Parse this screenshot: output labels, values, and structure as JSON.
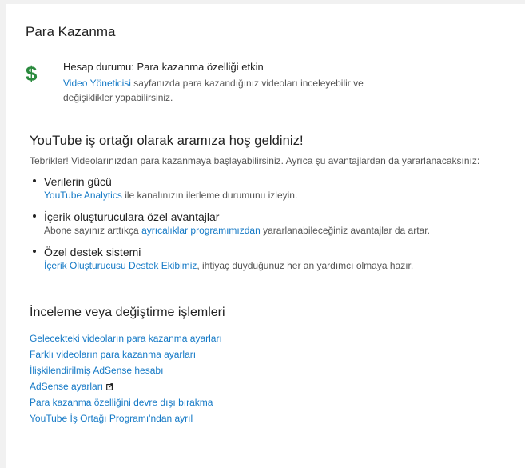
{
  "page_title": "Para Kazanma",
  "status": {
    "icon": "dollar-icon",
    "line": "Hesap durumu: Para kazanma özelliği etkin",
    "desc_link": "Video Yöneticisi",
    "desc_rest": " sayfanızda para kazandığınız videoları inceleyebilir ve değişiklikler yapabilirsiniz."
  },
  "welcome": {
    "title": "YouTube iş ortağı olarak aramıza hoş geldiniz!",
    "intro": "Tebrikler! Videolarınızdan para kazanmaya başlayabilirsiniz. Ayrıca şu avantajlardan da yararlanacaksınız:",
    "benefits": [
      {
        "title": "Verilerin gücü",
        "pre": "",
        "link": "YouTube Analytics",
        "post": " ile kanalınızın ilerleme durumunu izleyin."
      },
      {
        "title": "İçerik oluşturuculara özel avantajlar",
        "pre": "Abone sayınız arttıkça ",
        "link": "ayrıcalıklar programımızdan",
        "post": " yararlanabileceğiniz avantajlar da artar."
      },
      {
        "title": "Özel destek sistemi",
        "pre": "",
        "link": "İçerik Oluşturucusu Destek Ekibimiz",
        "post": ", ihtiyaç duyduğunuz her an yardımcı olmaya hazır."
      }
    ]
  },
  "review": {
    "title": "İnceleme veya değiştirme işlemleri",
    "links": [
      "Gelecekteki videoların para kazanma ayarları",
      "Farklı videoların para kazanma ayarları",
      "İlişkilendirilmiş AdSense hesabı",
      "AdSense ayarları",
      "Para kazanma özelliğini devre dışı bırakma",
      "YouTube İş Ortağı Programı'ndan ayrıl"
    ]
  },
  "colors": {
    "link": "#167ac6",
    "icon_green": "#2b8a3e",
    "background": "#f1f1f1"
  }
}
